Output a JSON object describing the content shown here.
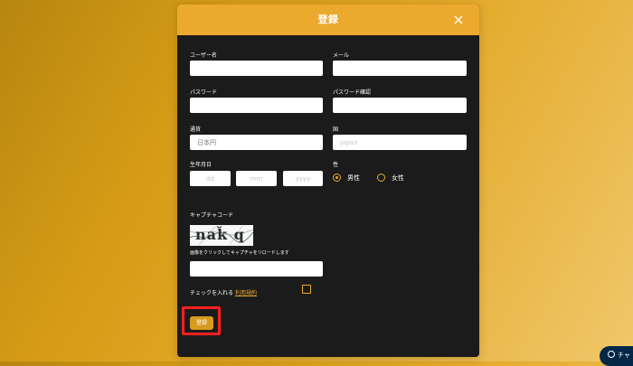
{
  "modal": {
    "title": "登録",
    "close": "×"
  },
  "form": {
    "username": {
      "label": "ユーザー名",
      "value": ""
    },
    "email": {
      "label": "メール",
      "value": ""
    },
    "password": {
      "label": "パスワード",
      "value": ""
    },
    "password_confirm": {
      "label": "パスワード確認",
      "value": ""
    },
    "currency": {
      "label": "通貨",
      "value": "日本円"
    },
    "country": {
      "label": "国",
      "placeholder": "Japan"
    },
    "birthdate": {
      "label": "生年月日",
      "day_placeholder": "dd",
      "month_placeholder": "mm",
      "year_placeholder": "yyyy"
    },
    "gender": {
      "label": "性",
      "options": [
        {
          "label": "男性",
          "selected": true
        },
        {
          "label": "女性",
          "selected": false
        }
      ]
    },
    "captcha": {
      "label": "キャプチャコード",
      "image_text": "naǩ q",
      "hint": "画像をクリックしてキャプチャをリロードします",
      "value": ""
    },
    "terms": {
      "text": "チェックを入れる",
      "link": "利用規約",
      "checked": false
    },
    "submit_label": "登録"
  },
  "chat": {
    "label": "チャ"
  },
  "colors": {
    "accent": "#eba92d",
    "modal_bg": "#1c1b1b",
    "highlight": "#ff1f1f"
  },
  "icons": {
    "close": "close-icon",
    "chat": "chat-icon",
    "captcha": "captcha-image"
  }
}
